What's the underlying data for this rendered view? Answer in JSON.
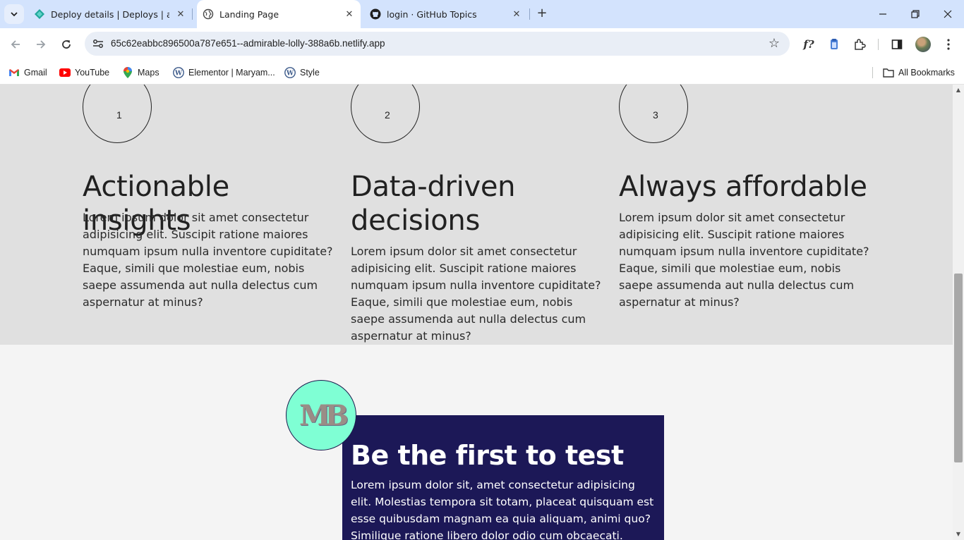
{
  "browser": {
    "tabs": [
      {
        "title": "Deploy details | Deploys | admi",
        "favicon": "netlify-icon",
        "active": false
      },
      {
        "title": "Landing Page",
        "favicon": "globe-icon",
        "active": true
      },
      {
        "title": "login · GitHub Topics",
        "favicon": "github-icon",
        "active": false
      }
    ],
    "url": "65c62eabbc896500a787e651--admirable-lolly-388a6b.netlify.app",
    "bookmarks": [
      {
        "label": "Gmail",
        "icon": "gmail-icon"
      },
      {
        "label": "YouTube",
        "icon": "youtube-icon"
      },
      {
        "label": "Maps",
        "icon": "maps-icon"
      },
      {
        "label": "Elementor | Maryam...",
        "icon": "wordpress-icon"
      },
      {
        "label": "Style",
        "icon": "wordpress-icon"
      }
    ],
    "all_bookmarks": "All Bookmarks"
  },
  "features": [
    {
      "number": "1",
      "title": "Actionable insights",
      "text": "Lorem ipsum dolor sit amet consectetur adipisicing elit. Suscipit ratione maiores numquam ipsum nulla inventore cupiditate? Eaque, simili que molestiae eum, nobis saepe assumenda aut nulla delectus cum aspernatur at minus?"
    },
    {
      "number": "2",
      "title": "Data-driven decisions",
      "text": "Lorem ipsum dolor sit amet consectetur adipisicing elit. Suscipit ratione maiores numquam ipsum nulla inventore cupiditate? Eaque, simili que molestiae eum, nobis saepe assumenda aut nulla delectus cum aspernatur at minus?"
    },
    {
      "number": "3",
      "title": "Always affordable",
      "text": "Lorem ipsum dolor sit amet consectetur adipisicing elit. Suscipit ratione maiores numquam ipsum nulla inventore cupiditate? Eaque, simili que molestiae eum, nobis saepe assumenda aut nulla delectus cum aspernatur at minus?"
    }
  ],
  "cta": {
    "logo_text": "MB",
    "title": "Be the first to test",
    "text": "Lorem ipsum dolor sit, amet consectetur adipisicing elit. Molestias tempora sit totam, placeat quisquam est esse quibusdam magnam ea quia aliquam, animi quo? Similique ratione libero dolor odio cum obcaecati."
  },
  "colors": {
    "tab_strip": "#d3e3fd",
    "features_bg": "#e0e0e0",
    "page_bg": "#f4f4f4",
    "cta_bg": "#1c1857",
    "logo_bg": "#7fffd4"
  }
}
